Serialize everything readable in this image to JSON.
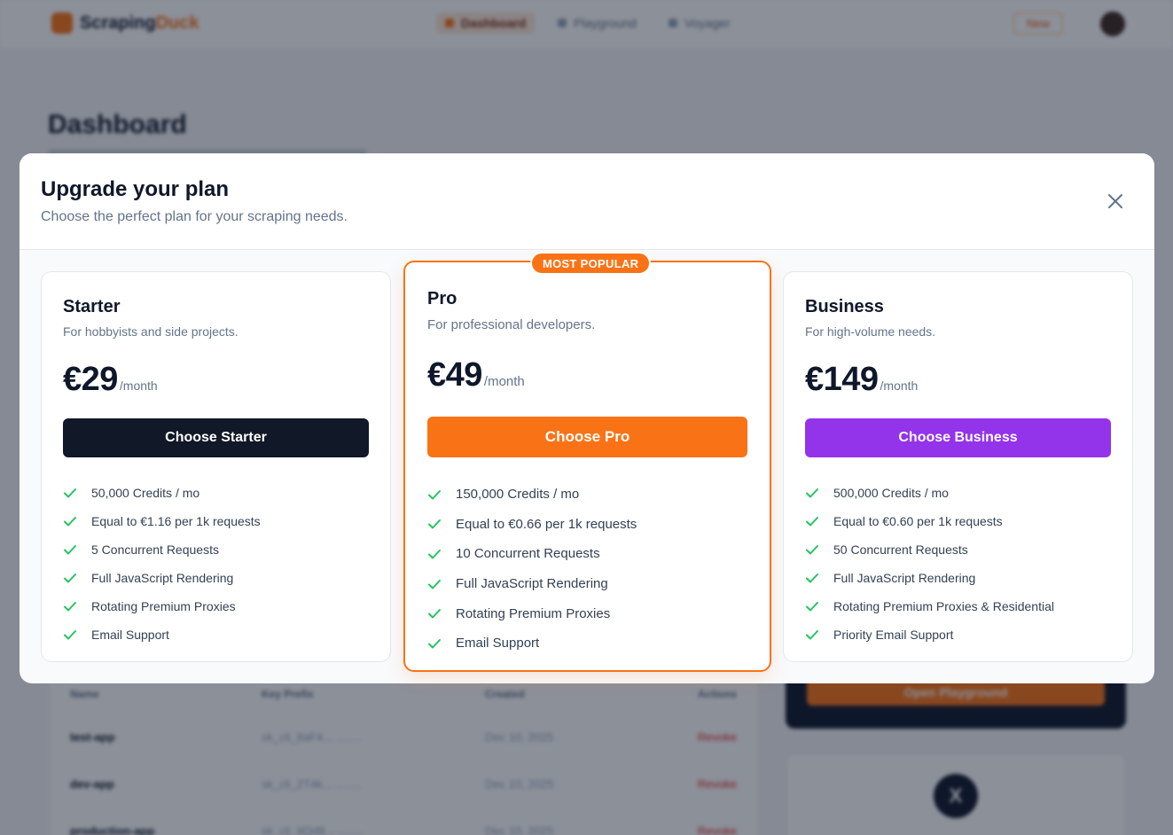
{
  "app": {
    "brand_main": "Scraping",
    "brand_accent": "Duck",
    "nav": [
      {
        "label": "Dashboard",
        "active": true
      },
      {
        "label": "Playground",
        "active": false
      },
      {
        "label": "Voyager",
        "active": false
      }
    ],
    "new_label": "New",
    "page_title": "Dashboard",
    "table": {
      "headers": [
        "Name",
        "Key Prefix",
        "Created",
        "Actions"
      ],
      "rows": [
        {
          "name": "test-app",
          "prefix": "sk_cli_8aF4... ........",
          "created": "Dec 10, 2025",
          "action": "Revoke"
        },
        {
          "name": "dev-app",
          "prefix": "sk_cli_2T4k... ........",
          "created": "Dec 10, 2025",
          "action": "Revoke"
        },
        {
          "name": "production-app",
          "prefix": "sk_cli_9Qd8... ........",
          "created": "Dec 10, 2025",
          "action": "Revoke"
        }
      ]
    },
    "playground_button": "Open Playground"
  },
  "modal": {
    "title": "Upgrade your plan",
    "subtitle": "Choose the perfect plan for your scraping needs.",
    "plans": [
      {
        "name": "Starter",
        "description": "For hobbyists and side projects.",
        "price": "€29",
        "period": "/month",
        "cta": "Choose Starter",
        "cta_color": "#111827",
        "features": [
          "50,000 Credits / mo",
          "Equal to €1.16 per 1k requests",
          "5 Concurrent Requests",
          "Full JavaScript Rendering",
          "Rotating Premium Proxies",
          "Email Support"
        ]
      },
      {
        "name": "Pro",
        "badge": "MOST POPULAR",
        "description": "For professional developers.",
        "price": "€49",
        "period": "/month",
        "cta": "Choose Pro",
        "cta_color": "#f97316",
        "features": [
          "150,000 Credits / mo",
          "Equal to €0.66 per 1k requests",
          "10 Concurrent Requests",
          "Full JavaScript Rendering",
          "Rotating Premium Proxies",
          "Email Support"
        ]
      },
      {
        "name": "Business",
        "description": "For high-volume needs.",
        "price": "€149",
        "period": "/month",
        "cta": "Choose Business",
        "cta_color": "#9333ea",
        "features": [
          "500,000 Credits / mo",
          "Equal to €0.60 per 1k requests",
          "50 Concurrent Requests",
          "Full JavaScript Rendering",
          "Rotating Premium Proxies & Residential",
          "Priority Email Support"
        ]
      }
    ],
    "check_color": "#22c55e"
  }
}
